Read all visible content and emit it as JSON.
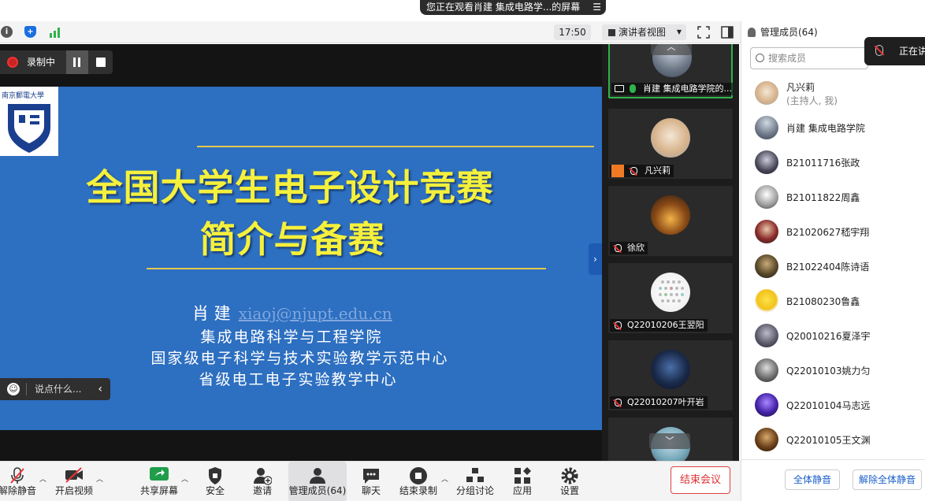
{
  "banner": {
    "text": "您正在观看肖建 集成电路学...的屏幕",
    "menu_icon": "list-icon"
  },
  "topbar": {
    "icons": [
      "info-icon",
      "shield-icon",
      "signal-icon"
    ],
    "colors": {
      "shield": "#1a6fe0",
      "signal": "#2fb34a"
    },
    "clock": "17:50",
    "view_label": "演讲者视图"
  },
  "recording": {
    "label": "录制中"
  },
  "chat": {
    "placeholder": "说点什么..."
  },
  "slide": {
    "title_line1": "全国大学生电子设计竞赛",
    "title_line2": "简介与备赛",
    "author": "肖 建",
    "email": "xiaoj@njupt.edu.cn",
    "lines": [
      "集成电路科学与工程学院",
      "国家级电子科学与技术实验教学示范中心",
      "省级电工电子实验教学中心"
    ],
    "colors": {
      "background": "#2d6fc0",
      "title": "#f5f03c"
    }
  },
  "gallery": {
    "tiles": [
      {
        "name": "肖建 集成电路学院的..."
      },
      {
        "name": "凡兴莉"
      },
      {
        "name": "徐欣"
      },
      {
        "name": "Q22010206王翌阳"
      },
      {
        "name": "Q22010207叶开岩"
      }
    ],
    "active_color": "#2fb34a"
  },
  "panel": {
    "title": "管理成员(64)",
    "search_placeholder": "搜索成员",
    "toast": "正在讲",
    "members": [
      {
        "name": "凡兴莉",
        "sub": "(主持人, 我)"
      },
      {
        "name": "肖建 集成电路学院"
      },
      {
        "name": "B21011716张政"
      },
      {
        "name": "B21011822周鑫"
      },
      {
        "name": "B21020627嵇宇翔"
      },
      {
        "name": "B21022404陈诗语"
      },
      {
        "name": "B21080230鲁鑫"
      },
      {
        "name": "Q20010216夏泽宇"
      },
      {
        "name": "Q22010103姚力匀"
      },
      {
        "name": "Q22010104马志远"
      },
      {
        "name": "Q22010105王文渊"
      }
    ],
    "mute_all": "全体静音",
    "unmute_all": "解除全体静音"
  },
  "toolbar": {
    "unmute": "解除静音",
    "video": "开启视频",
    "share": "共享屏幕",
    "security": "安全",
    "invite": "邀请",
    "members": "管理成员(64)",
    "chat": "聊天",
    "stop_record": "结束录制",
    "breakout": "分组讨论",
    "apps": "应用",
    "settings": "设置",
    "end": "结束会议"
  }
}
